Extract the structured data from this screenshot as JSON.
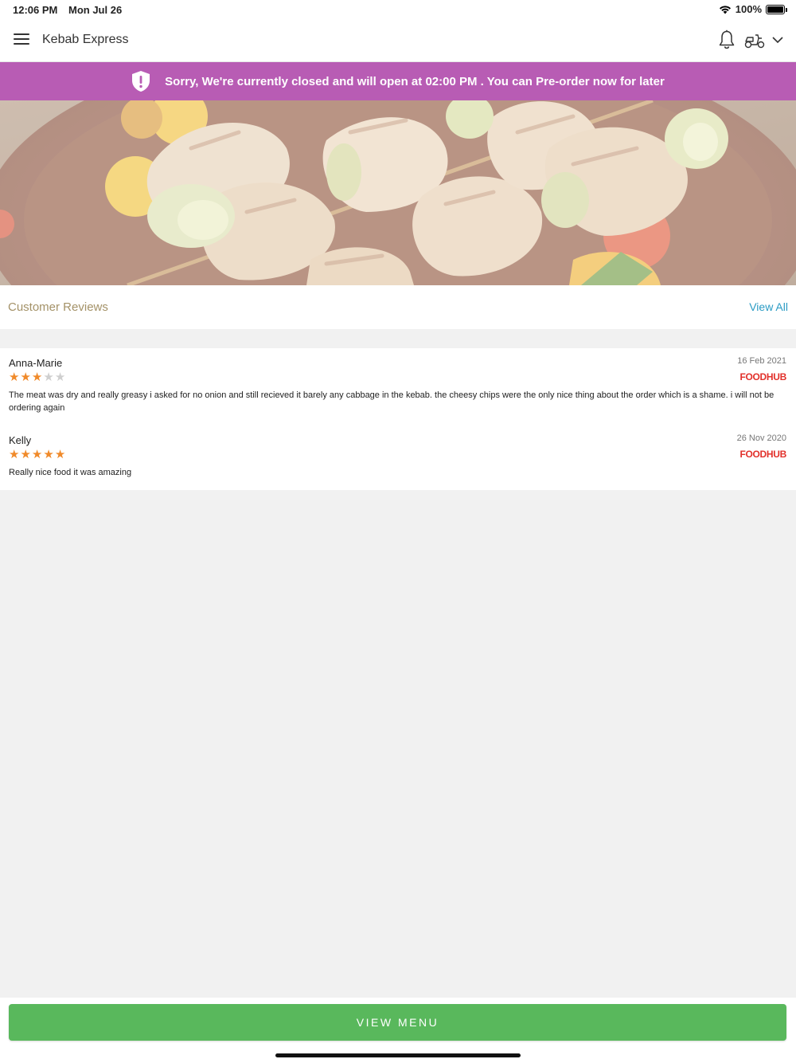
{
  "status_bar": {
    "time": "12:06 PM",
    "date": "Mon Jul 26",
    "battery": "100%",
    "battery_level": 1.0
  },
  "header": {
    "title": "Kebab Express",
    "icons": [
      "menu-icon",
      "bell-icon",
      "scooter-icon",
      "chevron-down-icon"
    ]
  },
  "banner": {
    "text": "Sorry, We're currently closed and will open at 02:00 PM . You can Pre-order now for later",
    "color": "#b85cb4",
    "icon": "shield-alert-icon"
  },
  "reviews": {
    "title": "Customer Reviews",
    "view_all": "View All",
    "items": [
      {
        "name": "Anna-Marie",
        "date": "16 Feb 2021",
        "rating": 3,
        "max_rating": 5,
        "source": "FOODHUB",
        "text": "The meat was dry and really greasy i asked for no onion and still recieved it barely any cabbage in the kebab. the cheesy chips were the only nice thing about the order which is a shame. i will not be ordering again"
      },
      {
        "name": "Kelly",
        "date": "26 Nov 2020",
        "rating": 5,
        "max_rating": 5,
        "source": "FOODHUB",
        "text": "Really nice food it was amazing"
      }
    ]
  },
  "footer": {
    "view_menu": "VIEW MENU",
    "button_color": "#59b85c"
  },
  "colors": {
    "accent_link": "#2a9bc4",
    "star": "#f08a2a",
    "source_brand": "#e2312b",
    "section_title": "#a49268"
  }
}
